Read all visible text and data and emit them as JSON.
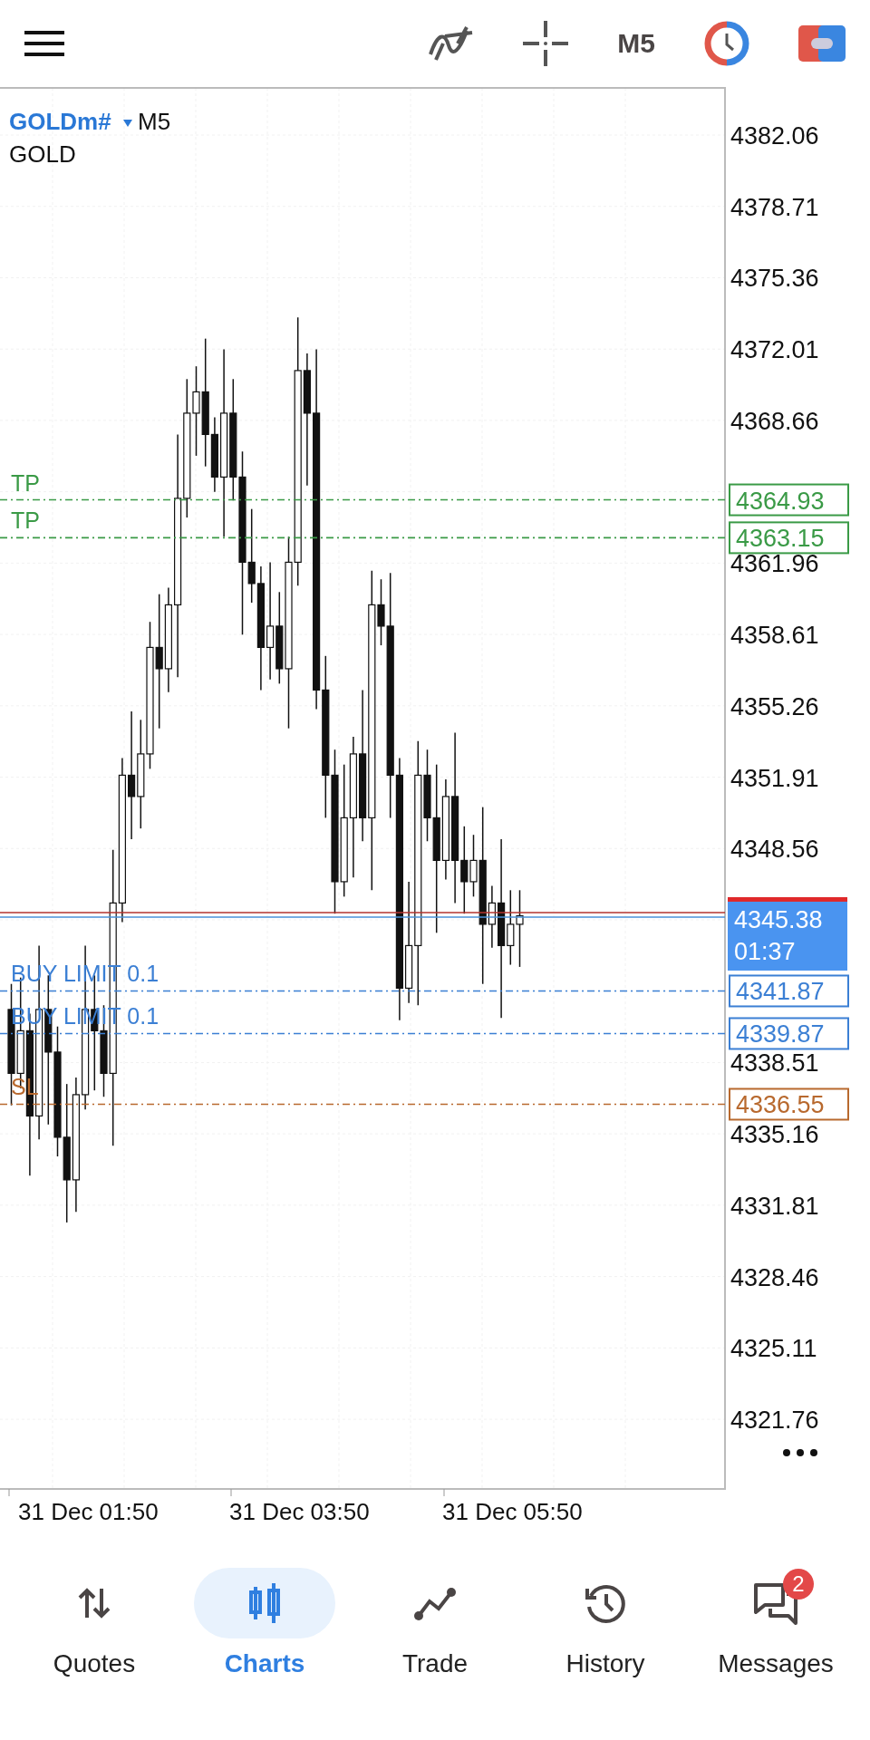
{
  "toolbar": {
    "timeframe": "M5"
  },
  "chart": {
    "symbol": "GOLDm#",
    "timeframe": "M5",
    "description": "GOLD",
    "price_axis": [
      "4382.06",
      "4378.71",
      "4375.36",
      "4372.01",
      "4368.66",
      "4361.96",
      "4358.61",
      "4355.26",
      "4351.91",
      "4348.56",
      "4338.51",
      "4335.16",
      "4331.81",
      "4328.46",
      "4325.11",
      "4321.76"
    ],
    "time_axis": [
      "31 Dec 01:50",
      "31 Dec 03:50",
      "31 Dec 05:50"
    ],
    "order_lines": [
      {
        "label": "TP",
        "price": "4364.93",
        "color": "#3a9a46"
      },
      {
        "label": "TP",
        "price": "4363.15",
        "color": "#3a9a46"
      },
      {
        "label": "BUY LIMIT 0.1",
        "price": "4341.87",
        "color": "#3b7fd4"
      },
      {
        "label": "BUY LIMIT 0.1",
        "price": "4339.87",
        "color": "#3b7fd4"
      },
      {
        "label": "SL",
        "price": "4336.55",
        "color": "#b8692e"
      }
    ],
    "current_price": {
      "bid": "4345.38",
      "countdown": "01:37"
    }
  },
  "nav": [
    {
      "label": "Quotes",
      "selected": false
    },
    {
      "label": "Charts",
      "selected": true
    },
    {
      "label": "Trade",
      "selected": false
    },
    {
      "label": "History",
      "selected": false
    },
    {
      "label": "Messages",
      "selected": false,
      "badge": "2"
    }
  ]
}
